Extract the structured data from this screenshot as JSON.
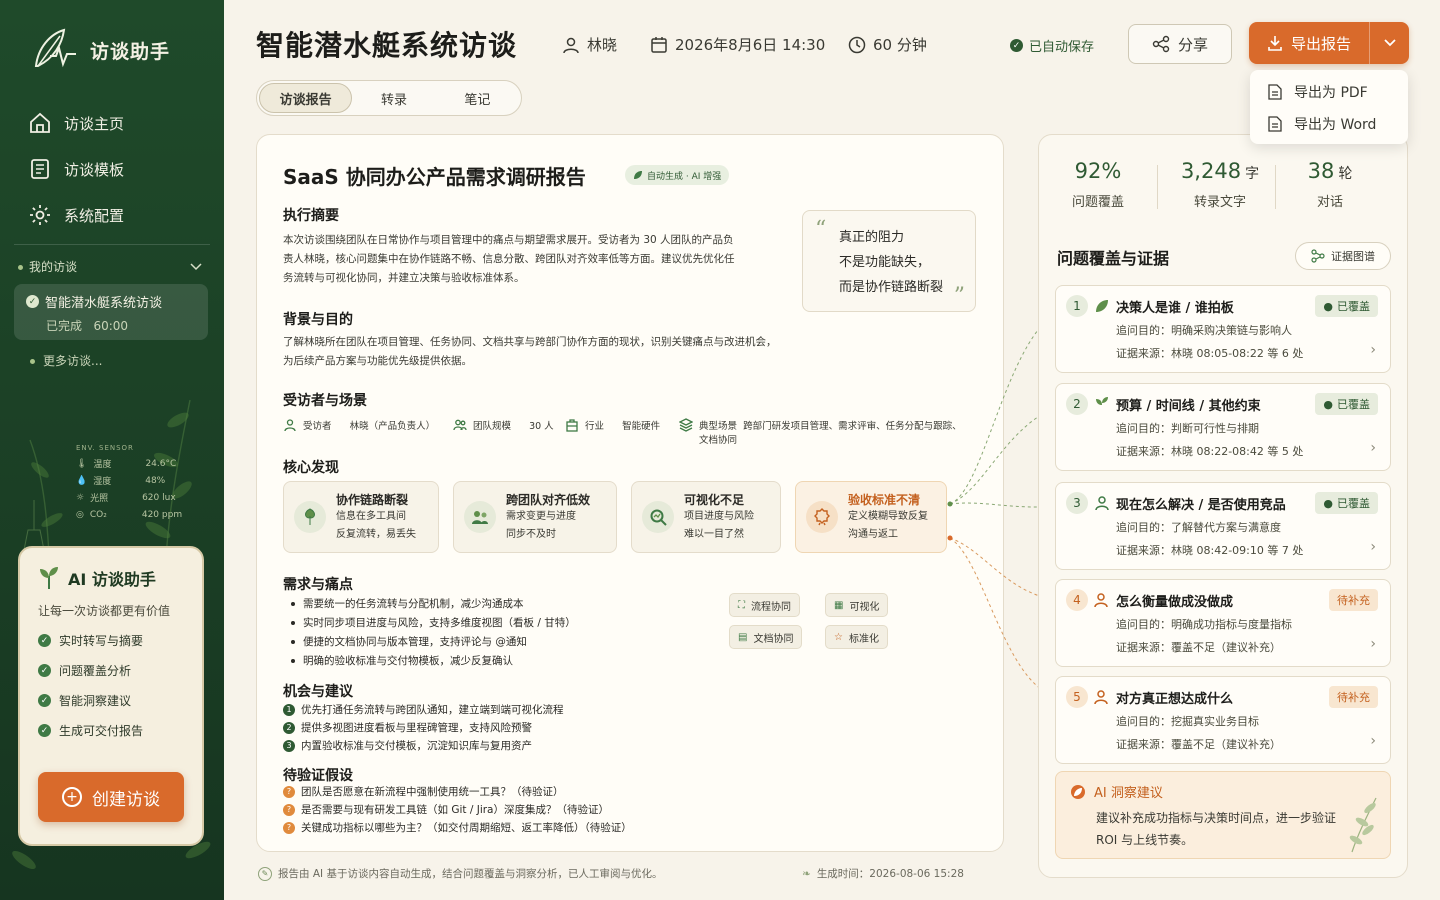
{
  "sidebar": {
    "brand": "访谈助手",
    "nav": [
      {
        "label": "访谈主页",
        "icon": "home-icon"
      },
      {
        "label": "访谈模板",
        "icon": "template-icon"
      },
      {
        "label": "系统配置",
        "icon": "gear-icon"
      }
    ],
    "my_interviews_label": "我的访谈",
    "current": {
      "title": "智能潜水艇系统访谈",
      "status": "已完成",
      "duration": "60:00"
    },
    "more_label": "更多访谈...",
    "sensor": {
      "header": "ENV. SENSOR",
      "rows": [
        {
          "k": "温度",
          "v": "24.6°C"
        },
        {
          "k": "湿度",
          "v": "48%"
        },
        {
          "k": "光照",
          "v": "620 lux"
        },
        {
          "k": "CO₂",
          "v": "420 ppm"
        }
      ]
    },
    "ai_card": {
      "title": "AI 访谈助手",
      "subtitle": "让每一次访谈都更有价值",
      "features": [
        "实时转写与摘要",
        "问题覆盖分析",
        "智能洞察建议",
        "生成可交付报告"
      ],
      "create_label": "创建访谈"
    }
  },
  "header": {
    "title": "智能潜水艇系统访谈",
    "interviewer": "林晓",
    "datetime": "2026年8月6日 14:30",
    "duration": "60 分钟",
    "saved": "已自动保存",
    "share": "分享",
    "export": "导出报告",
    "export_options": [
      "导出为 PDF",
      "导出为 Word"
    ]
  },
  "tabs": [
    "访谈报告",
    "转录",
    "笔记"
  ],
  "report": {
    "title": "SaaS 协同办公产品需求调研报告",
    "badge": "自动生成 · AI 增强",
    "summary_h": "执行摘要",
    "summary_lines": [
      "本次访谈围绕团队在日常协作与项目管理中的痛点与期望需求展开。受访者为 30 人团队的产品负",
      "责人林晓，核心问题集中在协作链路不畅、信息分散、跨团队对齐效率低等方面。建议优先优化任",
      "务流转与可视化协同，并建立决策与验收标准体系。"
    ],
    "quote_lines": [
      "真正的阻力",
      "不是功能缺失，",
      "而是协作链路断裂"
    ],
    "bg_h": "背景与目的",
    "bg_lines": [
      "了解林晓所在团队在项目管理、任务协同、文档共享与跨部门协作方面的现状，识别关键痛点与改进机会，",
      "为后续产品方案与功能优先级提供依据。"
    ],
    "persona_h": "受访者与场景",
    "persona": {
      "interviewee_k": "受访者",
      "interviewee_v": "林晓（产品负责人）",
      "team_k": "团队规模",
      "team_v": "30 人",
      "industry_k": "行业",
      "industry_v": "智能硬件",
      "scene_k": "典型场景",
      "scene_v1": "跨部门研发项目管理、需求评审、任务分配与跟踪、",
      "scene_v2": "文档协同"
    },
    "findings_h": "核心发现",
    "findings": [
      {
        "title": "协作链路断裂",
        "l1": "信息在多工具间",
        "l2": "反复流转，易丢失",
        "icon": "leaf-icon"
      },
      {
        "title": "跨团队对齐低效",
        "l1": "需求变更与进度",
        "l2": "同步不及时",
        "icon": "team-icon"
      },
      {
        "title": "可视化不足",
        "l1": "项目进度与风险",
        "l2": "难以一目了然",
        "icon": "magnifier-icon"
      },
      {
        "title": "验收标准不清",
        "l1": "定义模糊导致反复",
        "l2": "沟通与返工",
        "icon": "badge-icon"
      }
    ],
    "pain_h": "需求与痛点",
    "pains": [
      "需要统一的任务流转与分配机制，减少沟通成本",
      "实时同步项目进度与风险，支持多维度视图（看板 / 甘特）",
      "便捷的文档协同与版本管理，支持评论与 @通知",
      "明确的验收标准与交付物模板，减少反复确认"
    ],
    "tags": [
      "流程协同",
      "可视化",
      "文档协同",
      "标准化"
    ],
    "sugg_h": "机会与建议",
    "suggestions": [
      "优先打通任务流转与跨团队通知，建立端到端可视化流程",
      "提供多视图进度看板与里程碑管理，支持风险预警",
      "内置验收标准与交付模板，沉淀知识库与复用资产"
    ],
    "hyp_h": "待验证假设",
    "hypotheses": [
      "团队是否愿意在新流程中强制使用统一工具？（待验证）",
      "是否需要与现有研发工具链（如 Git / Jira）深度集成？（待验证）",
      "关键成功指标以哪些为主？（如交付周期缩短、返工率降低）（待验证）"
    ]
  },
  "footer": {
    "note": "报告由 AI 基于访谈内容自动生成，结合问题覆盖与洞察分析，已人工审阅与优化。",
    "time": "生成时间：2026-08-06 15:28"
  },
  "panel": {
    "stats": [
      {
        "value": "92%",
        "unit": "",
        "label": "问题覆盖"
      },
      {
        "value": "3,248",
        "unit": "字",
        "label": "转录文字"
      },
      {
        "value": "38",
        "unit": "轮",
        "label": "对话"
      }
    ],
    "title": "问题覆盖与证据",
    "evidence_btn": "证据图谱",
    "questions": [
      {
        "n": "1",
        "title": "决策人是谁 / 谁拍板",
        "status": "已覆盖",
        "purpose": "追问目的：明确采购决策链与影响人",
        "source": "证据来源：林晓 08:05-08:22 等 6 处",
        "covered": true
      },
      {
        "n": "2",
        "title": "预算 / 时间线 / 其他约束",
        "status": "已覆盖",
        "purpose": "追问目的：判断可行性与排期",
        "source": "证据来源：林晓 08:22-08:42 等 5 处",
        "covered": true
      },
      {
        "n": "3",
        "title": "现在怎么解决 / 是否使用竞品",
        "status": "已覆盖",
        "purpose": "追问目的：了解替代方案与满意度",
        "source": "证据来源：林晓 08:42-09:10 等 7 处",
        "covered": true
      },
      {
        "n": "4",
        "title": "怎么衡量做成没做成",
        "status": "待补充",
        "purpose": "追问目的：明确成功指标与度量指标",
        "source": "证据来源：覆盖不足（建议补充）",
        "covered": false
      },
      {
        "n": "5",
        "title": "对方真正想达成什么",
        "status": "待补充",
        "purpose": "追问目的：挖掘真实业务目标",
        "source": "证据来源：覆盖不足（建议补充）",
        "covered": false
      }
    ],
    "insight_title": "AI 洞察建议",
    "insight_text": "建议补充成功指标与决策时间点，进一步验证 ROI 与上线节奏。"
  },
  "colors": {
    "primary_green": "#1f4a2a",
    "accent_orange": "#d96a2b",
    "covered": "#2f5a33",
    "pending": "#c4611f"
  }
}
